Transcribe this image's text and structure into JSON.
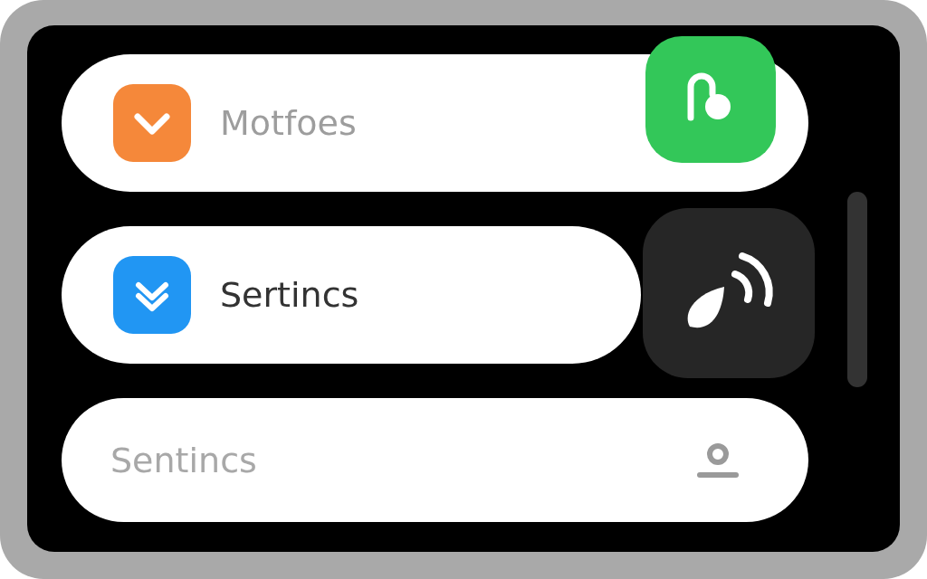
{
  "rows": [
    {
      "kind": "app",
      "label": "Motfoes",
      "color": "#f5883a",
      "disabled": true
    },
    {
      "kind": "app",
      "label": "Sertincs",
      "color": "#2196f3",
      "disabled": false
    }
  ],
  "field": {
    "placeholder": "Sentincs"
  },
  "actions": [
    {
      "kind": "shape",
      "color": "#33c759"
    },
    {
      "kind": "signal",
      "color": "#262626"
    }
  ]
}
